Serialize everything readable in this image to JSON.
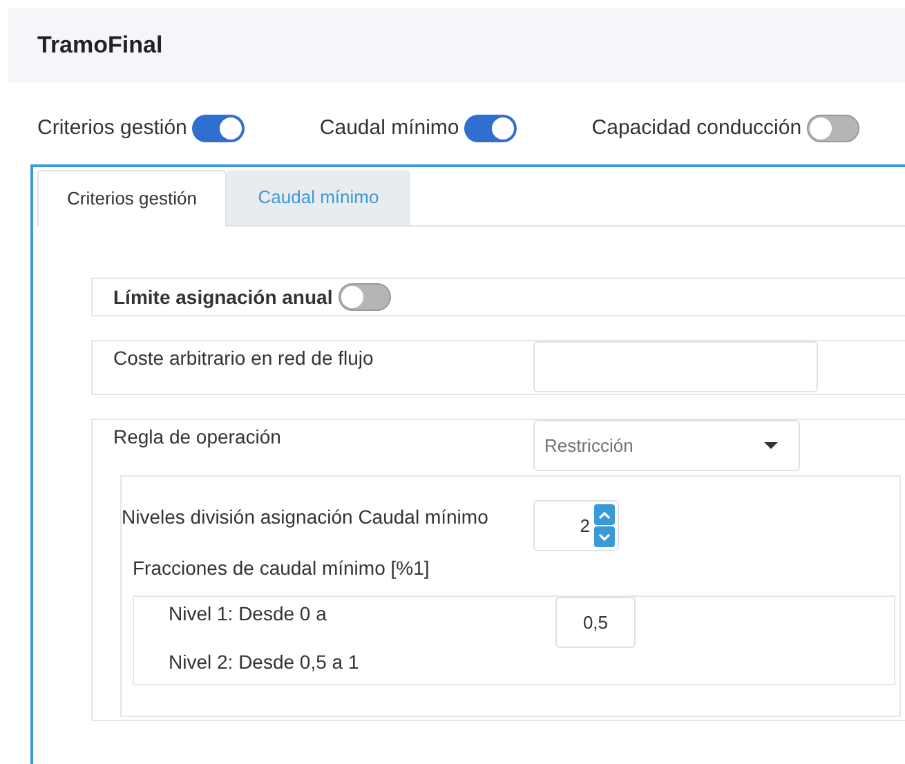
{
  "header": {
    "title": "TramoFinal"
  },
  "toggles": [
    {
      "label": "Criterios gestión",
      "on": true
    },
    {
      "label": "Caudal mínimo",
      "on": true
    },
    {
      "label": "Capacidad conducción",
      "on": false
    }
  ],
  "tabs": [
    {
      "label": "Criterios gestión",
      "selected": true
    },
    {
      "label": "Caudal mínimo",
      "selected": false
    }
  ],
  "limit": {
    "label": "Límite asignación anual",
    "on": false
  },
  "cost": {
    "label": "Coste arbitrario en red de flujo"
  },
  "rule": {
    "label": "Regla de operación",
    "value": "Restricción"
  },
  "levels": {
    "label": "Niveles división asignación Caudal mínimo",
    "value": "2"
  },
  "fractions": {
    "title": "Fracciones de caudal mínimo [%1]",
    "rows": [
      {
        "label": "Nivel 1: Desde 0 a",
        "value": "0,5"
      },
      {
        "label": "Nivel 2: Desde 0,5 a 1"
      }
    ]
  }
}
